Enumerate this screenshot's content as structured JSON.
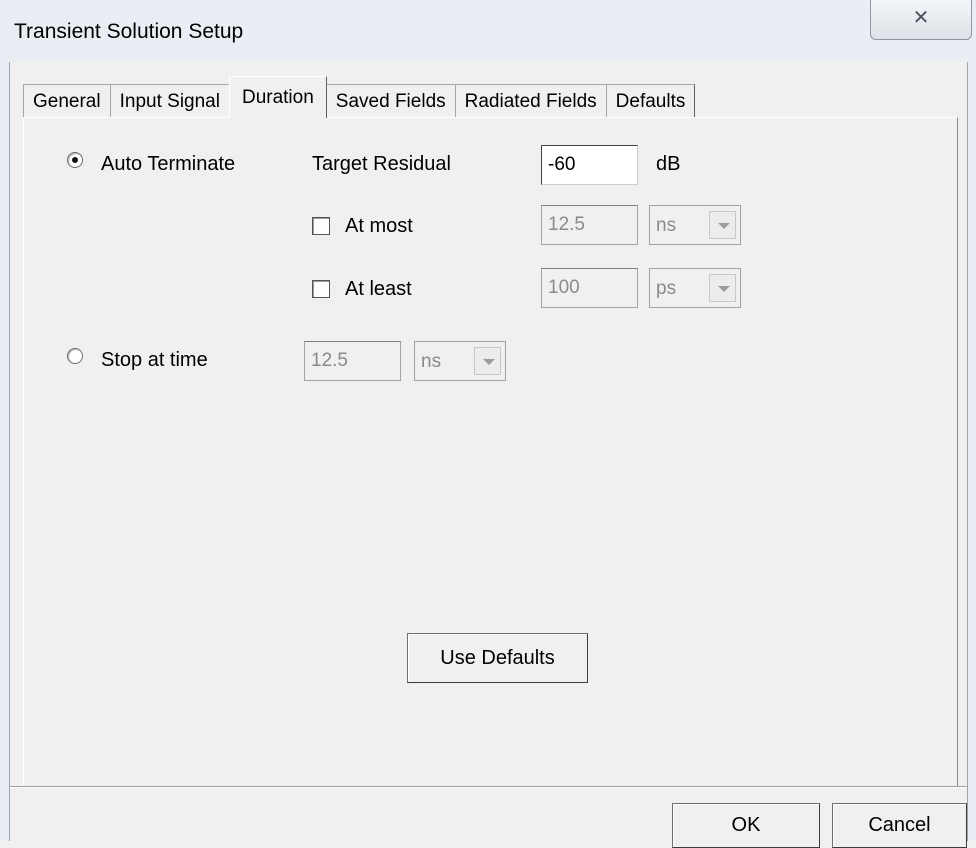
{
  "window": {
    "title": "Transient Solution Setup",
    "close_glyph": "✕"
  },
  "tabs": [
    {
      "label": "General"
    },
    {
      "label": "Input Signal"
    },
    {
      "label": "Duration"
    },
    {
      "label": "Saved Fields"
    },
    {
      "label": "Radiated Fields"
    },
    {
      "label": "Defaults"
    }
  ],
  "active_tab": "Duration",
  "duration": {
    "auto_terminate": {
      "label": "Auto Terminate",
      "selected": true
    },
    "target_residual": {
      "label": "Target Residual",
      "value": "-60",
      "unit": "dB"
    },
    "at_most": {
      "label": "At most",
      "checked": false,
      "value": "12.5",
      "unit": "ns"
    },
    "at_least": {
      "label": "At least",
      "checked": false,
      "value": "100",
      "unit": "ps"
    },
    "stop_at_time": {
      "label": "Stop at time",
      "selected": false,
      "value": "12.5",
      "unit": "ns"
    },
    "use_defaults_label": "Use Defaults"
  },
  "footer": {
    "ok_label": "OK",
    "cancel_label": "Cancel"
  }
}
